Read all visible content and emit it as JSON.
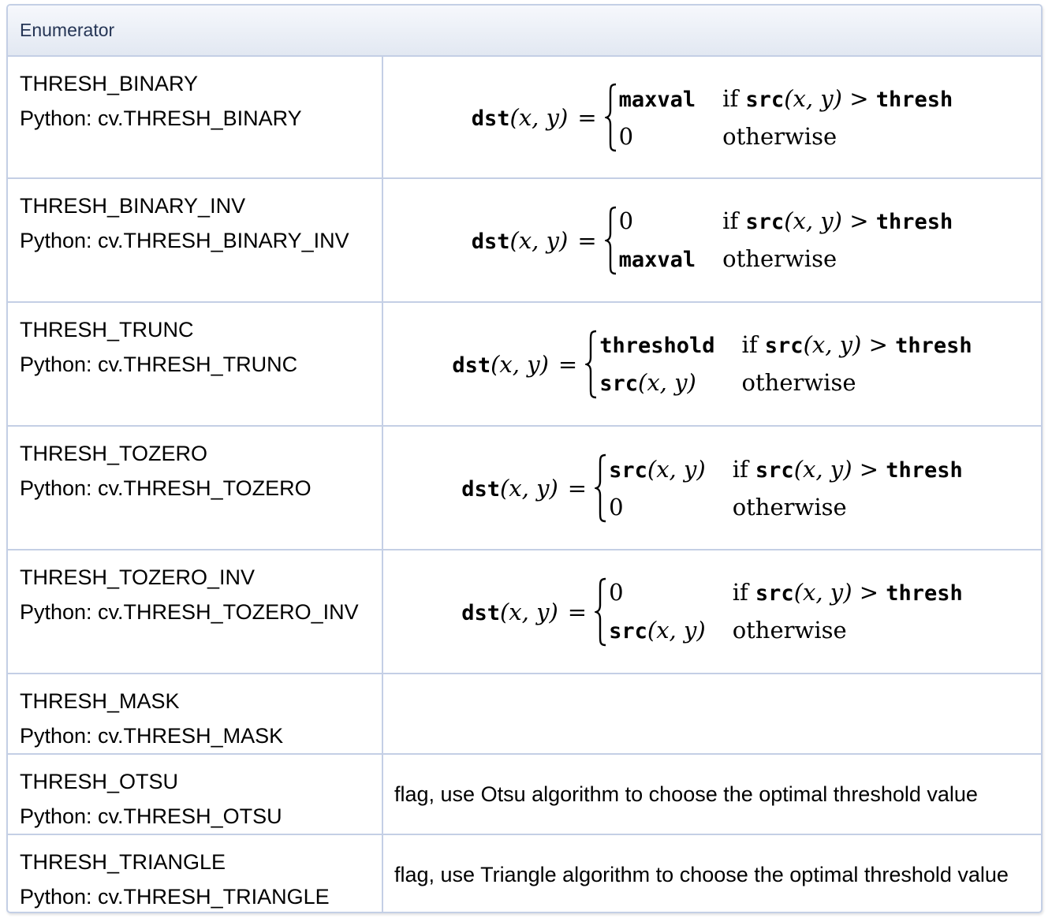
{
  "table": {
    "header": "Enumerator",
    "rows": [
      {
        "name": "THRESH_BINARY",
        "python": "Python: cv.THRESH_BINARY",
        "formula": {
          "lhs": "dst",
          "args": "(x, y)",
          "cases": [
            {
              "value": "maxval",
              "value_style": "mono",
              "cond": "if",
              "fn": "src",
              "fn_args": "(x, y)",
              "op": ">",
              "thr": "thresh"
            },
            {
              "value": "0",
              "value_style": "serif",
              "cond": "otherwise"
            }
          ]
        }
      },
      {
        "name": "THRESH_BINARY_INV",
        "python": "Python: cv.THRESH_BINARY_INV",
        "formula": {
          "lhs": "dst",
          "args": "(x, y)",
          "cases": [
            {
              "value": "0",
              "value_style": "serif",
              "cond": "if",
              "fn": "src",
              "fn_args": "(x, y)",
              "op": ">",
              "thr": "thresh"
            },
            {
              "value": "maxval",
              "value_style": "mono",
              "cond": "otherwise"
            }
          ]
        }
      },
      {
        "name": "THRESH_TRUNC",
        "python": "Python: cv.THRESH_TRUNC",
        "formula": {
          "lhs": "dst",
          "args": "(x, y)",
          "cases": [
            {
              "value": "threshold",
              "value_style": "mono",
              "cond": "if",
              "fn": "src",
              "fn_args": "(x, y)",
              "op": ">",
              "thr": "thresh"
            },
            {
              "value": "src",
              "value_args": "(x, y)",
              "value_style": "mono",
              "cond": "otherwise"
            }
          ]
        }
      },
      {
        "name": "THRESH_TOZERO",
        "python": "Python: cv.THRESH_TOZERO",
        "formula": {
          "lhs": "dst",
          "args": "(x, y)",
          "cases": [
            {
              "value": "src",
              "value_args": "(x, y)",
              "value_style": "mono",
              "cond": "if",
              "fn": "src",
              "fn_args": "(x, y)",
              "op": ">",
              "thr": "thresh"
            },
            {
              "value": "0",
              "value_style": "serif",
              "cond": "otherwise"
            }
          ]
        }
      },
      {
        "name": "THRESH_TOZERO_INV",
        "python": "Python: cv.THRESH_TOZERO_INV",
        "formula": {
          "lhs": "dst",
          "args": "(x, y)",
          "cases": [
            {
              "value": "0",
              "value_style": "serif",
              "cond": "if",
              "fn": "src",
              "fn_args": "(x, y)",
              "op": ">",
              "thr": "thresh"
            },
            {
              "value": "src",
              "value_args": "(x, y)",
              "value_style": "mono",
              "cond": "otherwise"
            }
          ]
        }
      },
      {
        "name": "THRESH_MASK",
        "python": "Python: cv.THRESH_MASK",
        "description": ""
      },
      {
        "name": "THRESH_OTSU",
        "python": "Python: cv.THRESH_OTSU",
        "description": "flag, use Otsu algorithm to choose the optimal threshold value"
      },
      {
        "name": "THRESH_TRIANGLE",
        "python": "Python: cv.THRESH_TRIANGLE",
        "description": "flag, use Triangle algorithm to choose the optimal threshold value"
      }
    ]
  },
  "colors": {
    "border": "#c4cfe5",
    "header_text": "#253555",
    "header_bg_top": "#f6f8fc",
    "header_bg_bottom": "#e2e8f2"
  }
}
